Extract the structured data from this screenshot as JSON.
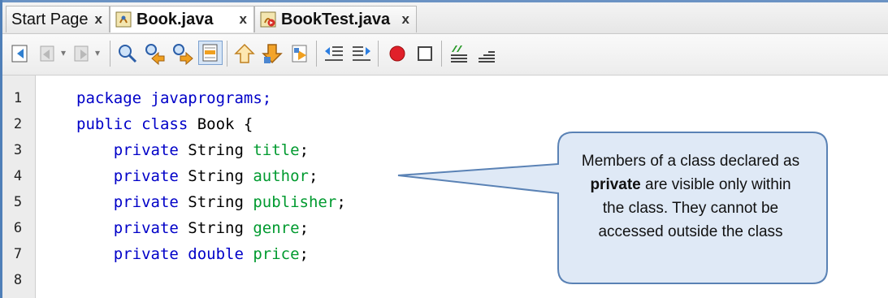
{
  "tabs": [
    {
      "label": "Start Page",
      "close": "x",
      "active": false
    },
    {
      "label": "Book.java",
      "close": "x",
      "active": true,
      "icon": "java-class-icon"
    },
    {
      "label": "BookTest.java",
      "close": "x",
      "active": false,
      "icon": "java-main-class-icon"
    }
  ],
  "toolbar": {
    "icons": [
      "last-edit-icon",
      "back-icon",
      "forward-icon",
      "find-selection-icon",
      "find-previous-icon",
      "find-next-icon",
      "toggle-highlight-icon",
      "previous-bookmark-icon",
      "next-bookmark-icon",
      "toggle-bookmark-icon",
      "shift-left-icon",
      "shift-right-icon",
      "start-macro-recording-icon",
      "stop-macro-recording-icon",
      "comment-icon",
      "uncomment-icon"
    ]
  },
  "editor": {
    "lines": [
      {
        "n": "1",
        "parts": [
          {
            "t": "package javaprograms;",
            "c": "kw"
          }
        ]
      },
      {
        "n": "2",
        "parts": [
          {
            "t": "public class ",
            "c": "kw"
          },
          {
            "t": "Book {",
            "c": "plain"
          }
        ]
      },
      {
        "n": "3",
        "parts": [
          {
            "t": "    private ",
            "c": "kw"
          },
          {
            "t": "String ",
            "c": "plain"
          },
          {
            "t": "title",
            "c": "fld"
          },
          {
            "t": ";",
            "c": "plain"
          }
        ]
      },
      {
        "n": "4",
        "parts": [
          {
            "t": "    private ",
            "c": "kw"
          },
          {
            "t": "String ",
            "c": "plain"
          },
          {
            "t": "author",
            "c": "fld"
          },
          {
            "t": ";",
            "c": "plain"
          }
        ]
      },
      {
        "n": "5",
        "parts": [
          {
            "t": "    private ",
            "c": "kw"
          },
          {
            "t": "String ",
            "c": "plain"
          },
          {
            "t": "publisher",
            "c": "fld"
          },
          {
            "t": ";",
            "c": "plain"
          }
        ]
      },
      {
        "n": "6",
        "parts": [
          {
            "t": "    private ",
            "c": "kw"
          },
          {
            "t": "String ",
            "c": "plain"
          },
          {
            "t": "genre",
            "c": "fld"
          },
          {
            "t": ";",
            "c": "plain"
          }
        ]
      },
      {
        "n": "7",
        "parts": [
          {
            "t": "    private double ",
            "c": "kw"
          },
          {
            "t": "price",
            "c": "fld"
          },
          {
            "t": ";",
            "c": "plain"
          }
        ]
      },
      {
        "n": "8",
        "parts": []
      }
    ]
  },
  "callout": {
    "line1": "Members of a class declared as",
    "bold": "private",
    "line2_rest": " are visible only within",
    "line3": "the class. They cannot be",
    "line4": "accessed outside the class"
  },
  "colors": {
    "keyword": "#0000c8",
    "field": "#009a2f",
    "callout_fill": "#dfe9f6",
    "callout_border": "#5a82b5",
    "record": "#e0202a"
  }
}
